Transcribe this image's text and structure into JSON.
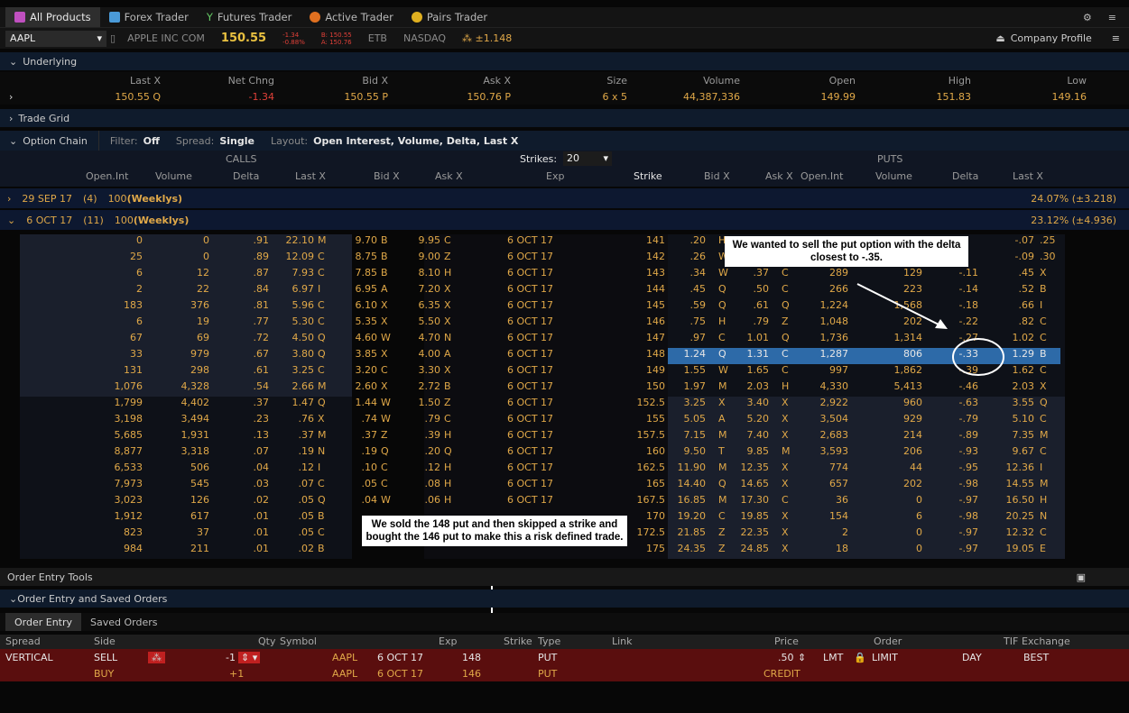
{
  "platform_tabs": [
    {
      "label": "All Products",
      "active": true
    },
    {
      "label": "Forex Trader"
    },
    {
      "label": "Futures Trader"
    },
    {
      "label": "Active Trader"
    },
    {
      "label": "Pairs Trader"
    }
  ],
  "quote": {
    "symbol": "AAPL",
    "company": "APPLE INC COM",
    "last": "150.55",
    "change": "-1.34",
    "change_pct": "-0.88%",
    "bid": "B: 150.55",
    "ask": "A: 150.76",
    "etb": "ETB",
    "exchange": "NASDAQ",
    "move": "±1.148",
    "company_profile": "Company Profile"
  },
  "underlying": {
    "title": "Underlying",
    "headers": [
      "Last X",
      "Net Chng",
      "Bid X",
      "Ask X",
      "Size",
      "Volume",
      "Open",
      "High",
      "Low"
    ],
    "values": [
      "150.55 Q",
      "-1.34",
      "150.55 P",
      "150.76 P",
      "6 x 5",
      "44,387,336",
      "149.99",
      "151.83",
      "149.16"
    ]
  },
  "trade_grid": "Trade Grid",
  "option_chain": {
    "title": "Option Chain",
    "filter_label": "Filter:",
    "filter": "Off",
    "spread_label": "Spread:",
    "spread": "Single",
    "layout_label": "Layout:",
    "layout": "Open Interest, Volume, Delta, Last X",
    "calls": "CALLS",
    "puts": "PUTS",
    "strikes_label": "Strikes:",
    "strikes": "20",
    "headers": {
      "oi": "Open.Int",
      "vol": "Volume",
      "delta": "Delta",
      "last": "Last X",
      "bid": "Bid X",
      "ask": "Ask X",
      "exp": "Exp",
      "strike": "Strike",
      "pbid": "Bid X",
      "pask": "Ask X",
      "poi": "Open.Int",
      "pvol": "Volume",
      "pdelta": "Delta",
      "plast": "Last X"
    },
    "expirations": [
      {
        "name": "29 SEP 17",
        "count": "(4)",
        "mult": "100",
        "tag": "(Weeklys)",
        "iv": "24.07% (±3.218)",
        "expanded": false
      },
      {
        "name": "6 OCT 17",
        "count": "(11)",
        "mult": "100",
        "tag": "(Weeklys)",
        "iv": "23.12% (±4.936)",
        "expanded": true
      }
    ],
    "rows": [
      {
        "c": [
          "0",
          "0",
          ".91",
          "22.10",
          "M",
          "9.70",
          "B",
          "9.95",
          "C"
        ],
        "exp": "6 OCT 17",
        "strike": "141",
        "p": [
          ".20",
          "H",
          "",
          "",
          "",
          "",
          "",
          "-.07",
          ".25",
          "B"
        ]
      },
      {
        "c": [
          "25",
          "0",
          ".89",
          "12.09",
          "C",
          "8.75",
          "B",
          "9.00",
          "Z"
        ],
        "exp": "6 OCT 17",
        "strike": "142",
        "p": [
          ".26",
          "W",
          "",
          "",
          "",
          "",
          "",
          "-.09",
          ".30",
          "Z"
        ]
      },
      {
        "c": [
          "6",
          "12",
          ".87",
          "7.93",
          "C",
          "7.85",
          "B",
          "8.10",
          "H"
        ],
        "exp": "6 OCT 17",
        "strike": "143",
        "p": [
          ".34",
          "W",
          ".37",
          "C",
          "289",
          "129",
          "-.11",
          ".45",
          "X"
        ]
      },
      {
        "c": [
          "2",
          "22",
          ".84",
          "6.97",
          "I",
          "6.95",
          "A",
          "7.20",
          "X"
        ],
        "exp": "6 OCT 17",
        "strike": "144",
        "p": [
          ".45",
          "Q",
          ".50",
          "C",
          "266",
          "223",
          "-.14",
          ".52",
          "B"
        ]
      },
      {
        "c": [
          "183",
          "376",
          ".81",
          "5.96",
          "C",
          "6.10",
          "X",
          "6.35",
          "X"
        ],
        "exp": "6 OCT 17",
        "strike": "145",
        "p": [
          ".59",
          "Q",
          ".61",
          "Q",
          "1,224",
          "1,568",
          "-.18",
          ".66",
          "I"
        ]
      },
      {
        "c": [
          "6",
          "19",
          ".77",
          "5.30",
          "C",
          "5.35",
          "X",
          "5.50",
          "X"
        ],
        "exp": "6 OCT 17",
        "strike": "146",
        "p": [
          ".75",
          "H",
          ".79",
          "Z",
          "1,048",
          "202",
          "-.22",
          ".82",
          "C"
        ]
      },
      {
        "c": [
          "67",
          "69",
          ".72",
          "4.50",
          "Q",
          "4.60",
          "W",
          "4.70",
          "N"
        ],
        "exp": "6 OCT 17",
        "strike": "147",
        "p": [
          ".97",
          "C",
          "1.01",
          "Q",
          "1,736",
          "1,314",
          "-.27",
          "1.02",
          "C"
        ]
      },
      {
        "c": [
          "33",
          "979",
          ".67",
          "3.80",
          "Q",
          "3.85",
          "X",
          "4.00",
          "A"
        ],
        "exp": "6 OCT 17",
        "strike": "148",
        "p": [
          "1.24",
          "Q",
          "1.31",
          "C",
          "1,287",
          "806",
          "-.33",
          "1.29",
          "B"
        ],
        "sel": true
      },
      {
        "c": [
          "131",
          "298",
          ".61",
          "3.25",
          "C",
          "3.20",
          "C",
          "3.30",
          "X"
        ],
        "exp": "6 OCT 17",
        "strike": "149",
        "p": [
          "1.55",
          "W",
          "1.65",
          "C",
          "997",
          "1,862",
          "-.39",
          "1.62",
          "C"
        ]
      },
      {
        "c": [
          "1,076",
          "4,328",
          ".54",
          "2.66",
          "M",
          "2.60",
          "X",
          "2.72",
          "B"
        ],
        "exp": "6 OCT 17",
        "strike": "150",
        "p": [
          "1.97",
          "M",
          "2.03",
          "H",
          "4,330",
          "5,413",
          "-.46",
          "2.03",
          "X"
        ]
      },
      {
        "c": [
          "1,799",
          "4,402",
          ".37",
          "1.47",
          "Q",
          "1.44",
          "W",
          "1.50",
          "Z"
        ],
        "exp": "6 OCT 17",
        "strike": "152.5",
        "p": [
          "3.25",
          "X",
          "3.40",
          "X",
          "2,922",
          "960",
          "-.63",
          "3.55",
          "Q"
        ]
      },
      {
        "c": [
          "3,198",
          "3,494",
          ".23",
          ".76",
          "X",
          ".74",
          "W",
          ".79",
          "C"
        ],
        "exp": "6 OCT 17",
        "strike": "155",
        "p": [
          "5.05",
          "A",
          "5.20",
          "X",
          "3,504",
          "929",
          "-.79",
          "5.10",
          "C"
        ]
      },
      {
        "c": [
          "5,685",
          "1,931",
          ".13",
          ".37",
          "M",
          ".37",
          "Z",
          ".39",
          "H"
        ],
        "exp": "6 OCT 17",
        "strike": "157.5",
        "p": [
          "7.15",
          "M",
          "7.40",
          "X",
          "2,683",
          "214",
          "-.89",
          "7.35",
          "M"
        ]
      },
      {
        "c": [
          "8,877",
          "3,318",
          ".07",
          ".19",
          "N",
          ".19",
          "Q",
          ".20",
          "Q"
        ],
        "exp": "6 OCT 17",
        "strike": "160",
        "p": [
          "9.50",
          "T",
          "9.85",
          "M",
          "3,593",
          "206",
          "-.93",
          "9.67",
          "C"
        ]
      },
      {
        "c": [
          "6,533",
          "506",
          ".04",
          ".12",
          "I",
          ".10",
          "C",
          ".12",
          "H"
        ],
        "exp": "6 OCT 17",
        "strike": "162.5",
        "p": [
          "11.90",
          "M",
          "12.35",
          "X",
          "774",
          "44",
          "-.95",
          "12.36",
          "I"
        ]
      },
      {
        "c": [
          "7,973",
          "545",
          ".03",
          ".07",
          "C",
          ".05",
          "C",
          ".08",
          "H"
        ],
        "exp": "6 OCT 17",
        "strike": "165",
        "p": [
          "14.40",
          "Q",
          "14.65",
          "X",
          "657",
          "202",
          "-.98",
          "14.55",
          "M"
        ]
      },
      {
        "c": [
          "3,023",
          "126",
          ".02",
          ".05",
          "Q",
          ".04",
          "W",
          ".06",
          "H"
        ],
        "exp": "6 OCT 17",
        "strike": "167.5",
        "p": [
          "16.85",
          "M",
          "17.30",
          "C",
          "36",
          "0",
          "-.97",
          "16.50",
          "H"
        ]
      },
      {
        "c": [
          "1,912",
          "617",
          ".01",
          ".05",
          "B",
          "",
          "",
          "",
          ""
        ],
        "exp": "",
        "strike": "170",
        "p": [
          "19.20",
          "C",
          "19.85",
          "X",
          "154",
          "6",
          "-.98",
          "20.25",
          "N"
        ]
      },
      {
        "c": [
          "823",
          "37",
          ".01",
          ".05",
          "C",
          "",
          "",
          "",
          ""
        ],
        "exp": "",
        "strike": "172.5",
        "p": [
          "21.85",
          "Z",
          "22.35",
          "X",
          "2",
          "0",
          "-.97",
          "12.32",
          "C"
        ]
      },
      {
        "c": [
          "984",
          "211",
          ".01",
          ".02",
          "B",
          "",
          "",
          "",
          ""
        ],
        "exp": "",
        "strike": "175",
        "p": [
          "24.35",
          "Z",
          "24.85",
          "X",
          "18",
          "0",
          "-.97",
          "19.05",
          "E"
        ]
      }
    ]
  },
  "annotations": {
    "top": "We wanted to sell the put option with the delta closest to -.35.",
    "bottom": "We sold the 148 put and then skipped a strike and bought the 146 put to make this a risk defined trade."
  },
  "order": {
    "tools": "Order Entry Tools",
    "section": "Order Entry and Saved Orders",
    "tabs": [
      "Order Entry",
      "Saved Orders"
    ],
    "headers": [
      "Spread",
      "Side",
      "Qty",
      "Symbol",
      "Exp",
      "Strike",
      "Type",
      "Link",
      "Price",
      "Order",
      "TIF",
      "Exchange"
    ],
    "row1": {
      "spread": "VERTICAL",
      "side": "SELL",
      "qty": "-1",
      "symbol": "AAPL",
      "exp": "6 OCT 17",
      "strike": "148",
      "type": "PUT",
      "price": ".50",
      "lmt": "LMT",
      "order": "LIMIT",
      "tif": "DAY",
      "exchange": "BEST"
    },
    "row2": {
      "side": "BUY",
      "qty": "+1",
      "symbol": "AAPL",
      "exp": "6 OCT 17",
      "strike": "146",
      "type": "PUT",
      "credit": "CREDIT"
    }
  }
}
